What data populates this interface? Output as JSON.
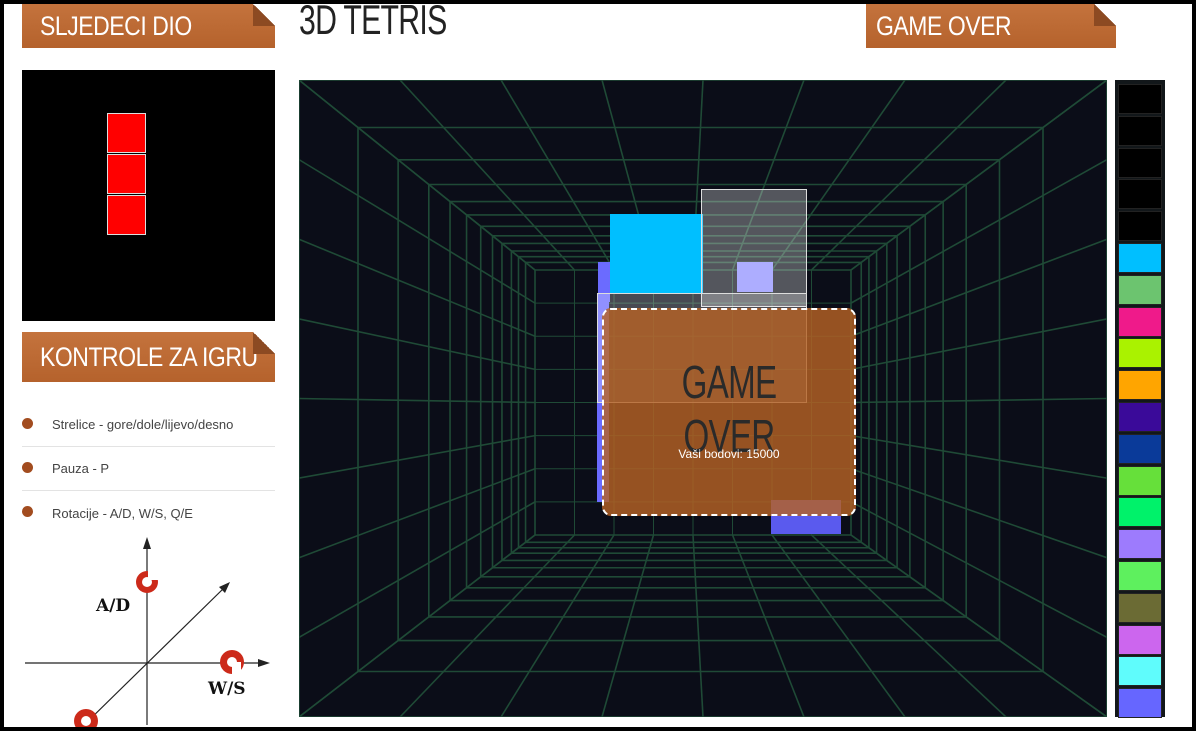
{
  "next_piece": {
    "heading": "SLJEDECI DIO",
    "color": "#ff0000"
  },
  "game": {
    "title": "3D TETRIS",
    "status": "GAME OVER"
  },
  "controls": {
    "heading": "KONTROLE ZA IGRU",
    "items": [
      {
        "label": "Strelice - gore/dole/lijevo/desno"
      },
      {
        "label": "Pauza - P"
      },
      {
        "label": "Rotacije - A/D, W/S, Q/E"
      }
    ],
    "diagram": {
      "label_ad": "A/D",
      "label_ws": "W/S"
    }
  },
  "overlay": {
    "title": "GAME OVER",
    "score_text": "Vaši bodovi: 15000"
  },
  "palette": {
    "colors": [
      "#000000",
      "#000000",
      "#000000",
      "#000000",
      "#000000",
      "#00bfff",
      "#6cc46f",
      "#ef1a8a",
      "#aaf200",
      "#ffa500",
      "#3a0a99",
      "#0a3a99",
      "#66e03a",
      "#00f26a",
      "#9d7bfd",
      "#5ef05e",
      "#6b6b34",
      "#cc66ee",
      "#5ffcfc",
      "#6666ff"
    ]
  },
  "colors": {
    "accent": "#b5622c",
    "board_bg": "#0b0d18",
    "grid": "#1f4a36"
  }
}
